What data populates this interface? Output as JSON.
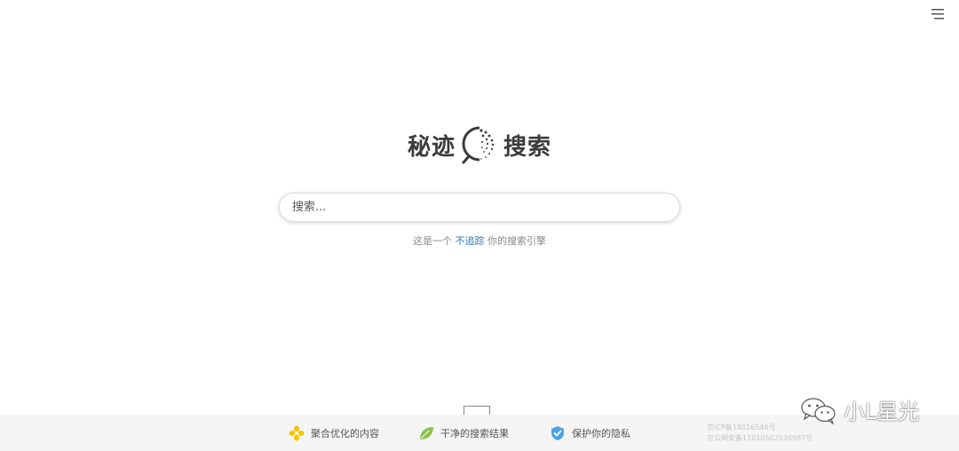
{
  "logo": {
    "left_text": "秘迹",
    "right_text": "搜索",
    "mark_icon": "magnifier-dotted-circle-icon"
  },
  "search": {
    "placeholder": "搜索...",
    "value": ""
  },
  "tagline": {
    "prefix": "这是一个 ",
    "highlight": "不追踪",
    "suffix": " 你的搜索引擎",
    "highlight_color": "#2b7bc2"
  },
  "menu": {
    "icon": "hamburger-menu-icon"
  },
  "footer": {
    "features": [
      {
        "label": "聚合优化的内容",
        "icon": "yellow-flower-icon"
      },
      {
        "label": "干净的搜索结果",
        "icon": "green-leaf-icon"
      },
      {
        "label": "保护你的隐私",
        "icon": "blue-shield-check-icon"
      }
    ],
    "icp_line1": "京ICP备18016546号",
    "icp_line2": "京公网安备11010502036987号"
  },
  "watermark": {
    "text": "小L星光",
    "icon": "wechat-logo-icon"
  },
  "colors": {
    "accent": "#2b7bc2",
    "footer_bg": "#f5f5f5",
    "leaf": "#8bc34a",
    "flower": "#f2c500",
    "shield": "#4aa3e8"
  }
}
